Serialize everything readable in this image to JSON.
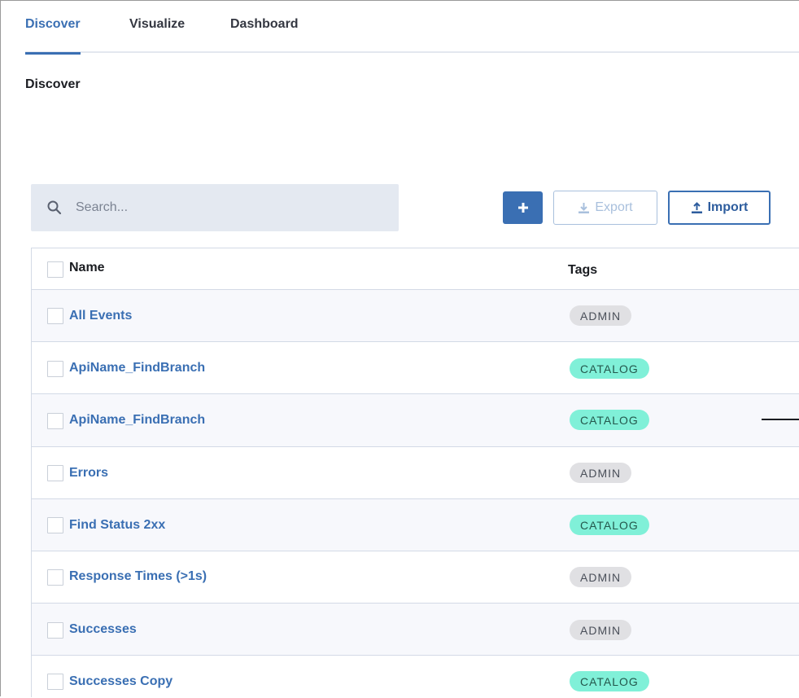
{
  "tabs": [
    {
      "label": "Discover",
      "active": true
    },
    {
      "label": "Visualize",
      "active": false
    },
    {
      "label": "Dashboard",
      "active": false
    }
  ],
  "page_title": "Discover",
  "search": {
    "placeholder": "Search...",
    "value": ""
  },
  "toolbar": {
    "add_icon": "plus-icon",
    "export_label": "Export",
    "export_icon": "download-icon",
    "import_label": "Import",
    "import_icon": "upload-icon"
  },
  "table": {
    "columns": [
      "Name",
      "Tags"
    ],
    "rows": [
      {
        "name": "All Events",
        "tag": "ADMIN",
        "tag_type": "admin"
      },
      {
        "name": "ApiName_FindBranch",
        "tag": "CATALOG",
        "tag_type": "catalog"
      },
      {
        "name": "ApiName_FindBranch",
        "tag": "CATALOG",
        "tag_type": "catalog"
      },
      {
        "name": "Errors",
        "tag": "ADMIN",
        "tag_type": "admin"
      },
      {
        "name": "Find Status 2xx",
        "tag": "CATALOG",
        "tag_type": "catalog"
      },
      {
        "name": "Response Times (>1s)",
        "tag": "ADMIN",
        "tag_type": "admin"
      },
      {
        "name": "Successes",
        "tag": "ADMIN",
        "tag_type": "admin"
      },
      {
        "name": "Successes Copy",
        "tag": "CATALOG",
        "tag_type": "catalog"
      }
    ]
  },
  "colors": {
    "accent": "#3a6fb3",
    "admin_tag": "#e0e0e3",
    "catalog_tag": "#80f0d8"
  }
}
